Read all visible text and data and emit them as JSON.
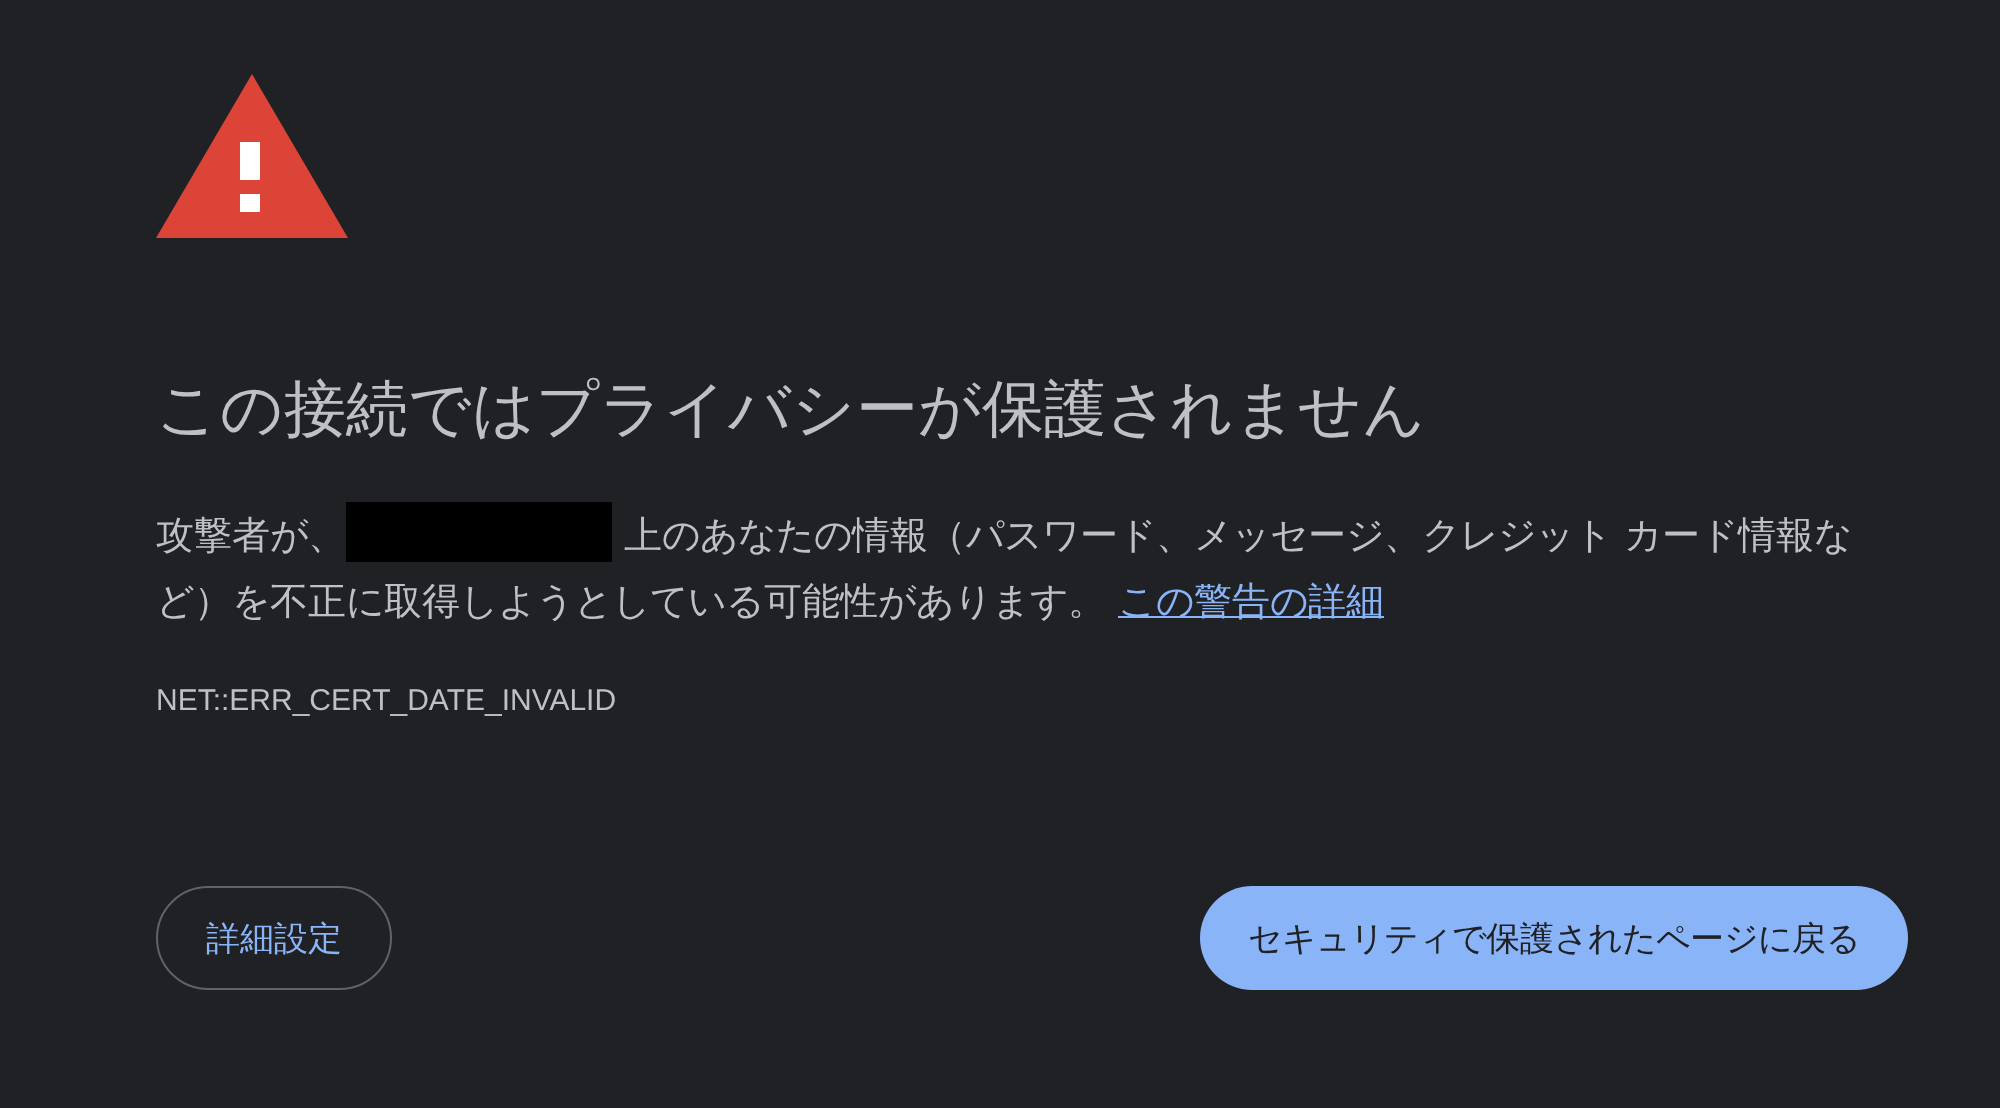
{
  "title": "この接続ではプライバシーが保護されません",
  "message": {
    "before": "攻撃者が、",
    "after": "上のあなたの情報（パスワード、メッセージ、クレジット カード情報など）を不正に取得しようとしている可能性があります。",
    "link": "この警告の詳細"
  },
  "error_code": "NET::ERR_CERT_DATE_INVALID",
  "buttons": [
    {
      "label": "詳細設定",
      "kind": "secondary"
    },
    {
      "label": "セキュリティで保護されたページに戻る",
      "kind": "primary"
    }
  ]
}
